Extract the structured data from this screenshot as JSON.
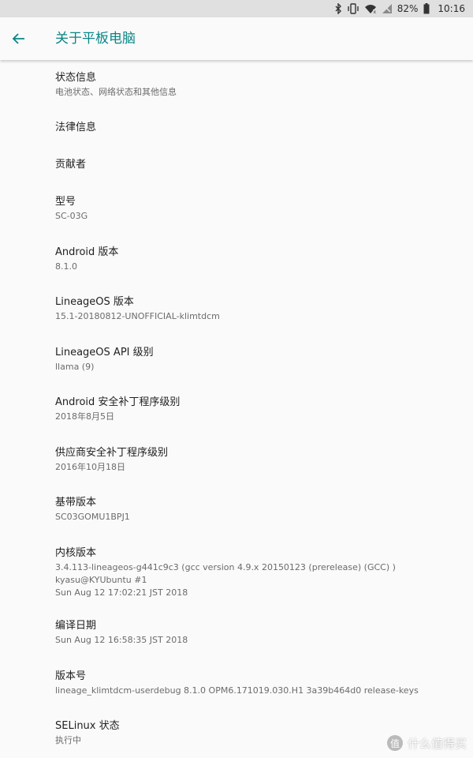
{
  "status_bar": {
    "battery": "82%",
    "time": "10:16",
    "icons": [
      "bluetooth-icon",
      "vibrate-icon",
      "wifi-icon",
      "signal-off-icon",
      "battery-icon"
    ]
  },
  "app_bar": {
    "back_icon": "arrow-left-icon",
    "title": "关于平板电脑",
    "accent_color": "#0a8585"
  },
  "items": [
    {
      "title": "状态信息",
      "summary": "电池状态、网络状态和其他信息"
    },
    {
      "title": "法律信息"
    },
    {
      "title": "贡献者"
    },
    {
      "title": "型号",
      "summary": "SC-03G"
    },
    {
      "title": "Android 版本",
      "summary": "8.1.0"
    },
    {
      "title": "LineageOS 版本",
      "summary": "15.1-20180812-UNOFFICIAL-klimtdcm"
    },
    {
      "title": "LineageOS API 级别",
      "summary": "llama (9)"
    },
    {
      "title": "Android 安全补丁程序级别",
      "summary": "2018年8月5日"
    },
    {
      "title": "供应商安全补丁程序级别",
      "summary": "2016年10月18日"
    },
    {
      "title": "基带版本",
      "summary": "SC03GOMU1BPJ1"
    },
    {
      "title": "内核版本",
      "summary_lines": [
        "3.4.113-lineageos-g441c9c3 (gcc version 4.9.x 20150123 (prerelease) (GCC) )",
        "kyasu@KYUbuntu #1",
        "Sun Aug 12 17:02:21 JST 2018"
      ]
    },
    {
      "title": "编译日期",
      "summary": "Sun Aug 12 16:58:35 JST 2018"
    },
    {
      "title": "版本号",
      "summary": "lineage_klimtdcm-userdebug 8.1.0 OPM6.171019.030.H1 3a39b464d0 release-keys"
    },
    {
      "title": "SELinux 状态",
      "summary": "执行中"
    }
  ],
  "watermark": {
    "logo_text": "值",
    "text": "什么值得买"
  }
}
